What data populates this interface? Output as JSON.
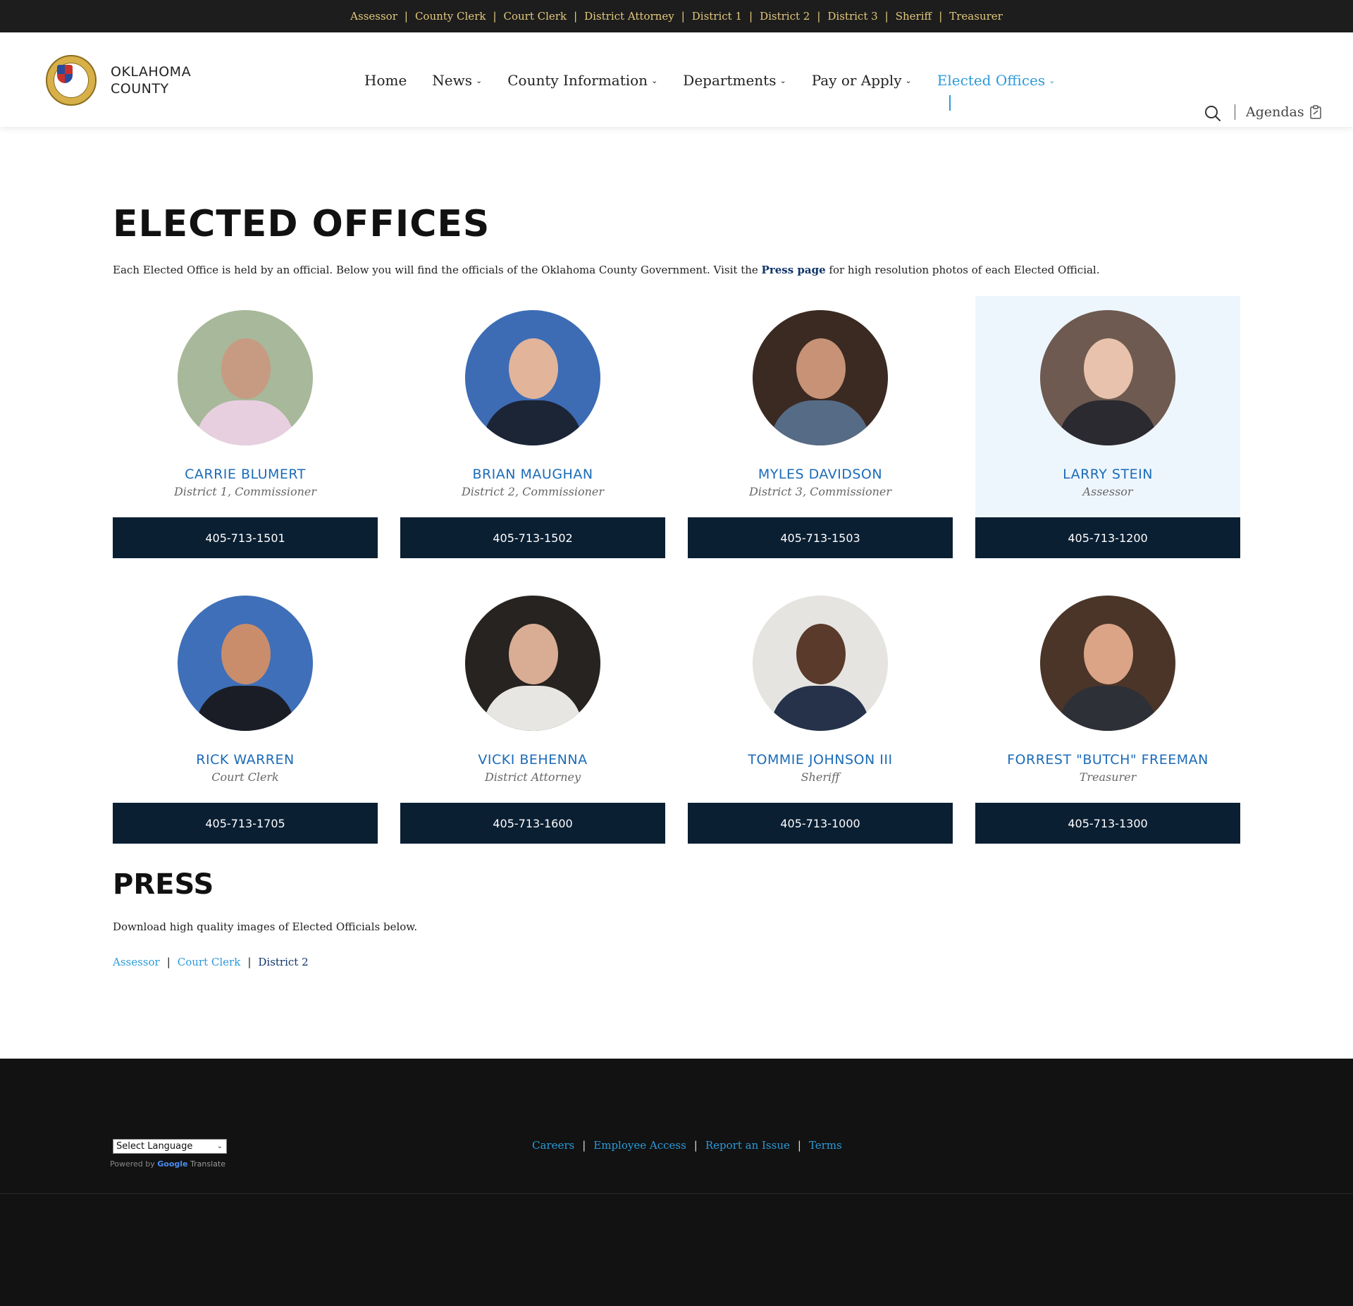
{
  "topbar": {
    "links": [
      "Assessor",
      "County Clerk",
      "Court Clerk",
      "District Attorney",
      "District 1",
      "District 2",
      "District 3",
      "Sheriff",
      "Treasurer"
    ]
  },
  "header": {
    "logo_line1": "OKLAHOMA",
    "logo_line2": "COUNTY",
    "nav": [
      {
        "label": "Home",
        "dropdown": false
      },
      {
        "label": "News",
        "dropdown": true
      },
      {
        "label": "County Information",
        "dropdown": true
      },
      {
        "label": "Departments",
        "dropdown": true
      },
      {
        "label": "Pay or Apply",
        "dropdown": true
      },
      {
        "label": "Elected Offices",
        "dropdown": true,
        "active": true
      }
    ],
    "agendas_label": "Agendas"
  },
  "main": {
    "title": "ELECTED OFFICES",
    "intro_before": "Each Elected Office is held by an official. Below you will find the officials of the Oklahoma County Government. Visit the ",
    "intro_link": "Press page",
    "intro_after": " for high resolution photos of each Elected Official.",
    "officials": [
      {
        "name": "CARRIE BLUMERT",
        "role": "District 1, Commissioner",
        "phone": "405-713-1501"
      },
      {
        "name": "BRIAN MAUGHAN",
        "role": "District 2, Commissioner",
        "phone": "405-713-1502"
      },
      {
        "name": "MYLES DAVIDSON",
        "role": "District 3, Commissioner",
        "phone": "405-713-1503"
      },
      {
        "name": "LARRY STEIN",
        "role": "Assessor",
        "phone": "405-713-1200"
      },
      {
        "name": "RICK WARREN",
        "role": "Court Clerk",
        "phone": "405-713-1705"
      },
      {
        "name": "VICKI BEHENNA",
        "role": "District Attorney",
        "phone": "405-713-1600"
      },
      {
        "name": "TOMMIE JOHNSON III",
        "role": "Sheriff",
        "phone": "405-713-1000"
      },
      {
        "name": "FORREST \"BUTCH\" FREEMAN",
        "role": "Treasurer",
        "phone": "405-713-1300"
      }
    ]
  },
  "press": {
    "title": "PRESS",
    "text": "Download high quality images of Elected Officials below.",
    "links": [
      "Assessor",
      "Court Clerk",
      "District 2"
    ]
  },
  "footer": {
    "language_select": "Select Language",
    "powered_by": "Powered by",
    "google": "Google",
    "translate": "Translate",
    "links": [
      "Careers",
      "Employee Access",
      "Report an Issue",
      "Terms"
    ]
  },
  "colors": {
    "accent": "#2b9ad9",
    "name_blue": "#1b6bb7",
    "phone_bg": "#0b1f33",
    "topbar_gold": "#e3c77c",
    "footer_bg": "#121212"
  }
}
